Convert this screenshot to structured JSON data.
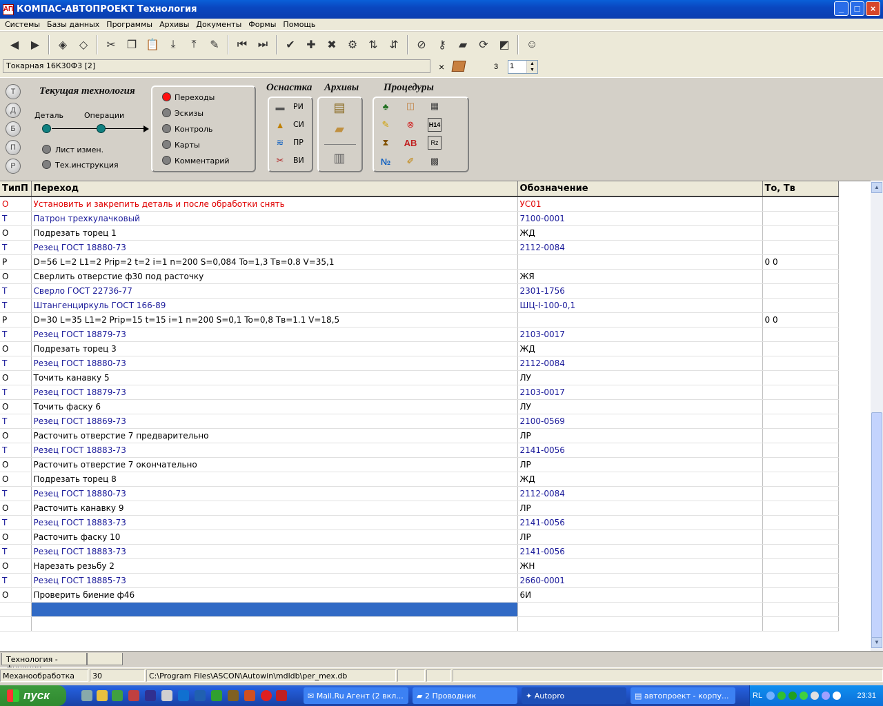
{
  "window": {
    "title": "КОМПАС-АВТОПРОЕКТ Технология",
    "app_icon": "АП"
  },
  "menu": [
    "Системы",
    "Базы данных",
    "Программы",
    "Архивы",
    "Документы",
    "Формы",
    "Помощь"
  ],
  "toolbar": {
    "icons": [
      "prev-icon",
      "next-icon",
      "sep",
      "check-icon",
      "uncheck-icon",
      "sep",
      "cut-icon",
      "copy-icon",
      "paste-icon",
      "import-icon",
      "export-icon",
      "edit-icon",
      "sep",
      "first-icon",
      "last-icon",
      "sep",
      "tool-check-icon",
      "tool-add-icon",
      "tool-remove-icon",
      "tools-icon",
      "sort-az-icon",
      "sort-za-icon",
      "sep",
      "stop-icon",
      "key-icon",
      "folder-icon",
      "refresh-icon",
      "erase-icon",
      "sep",
      "run-icon"
    ]
  },
  "combo": {
    "value": "Токарная 16К30Ф3  [2]",
    "close": "×",
    "count": "3",
    "spin_value": "1"
  },
  "panel": {
    "side_buttons": [
      "Т",
      "Д",
      "Б",
      "П",
      "Р"
    ],
    "current_tech": "Текущая технология",
    "detail": "Деталь",
    "operations": "Операции",
    "change_sheet": "Лист измен.",
    "tech_instr": "Тех.инструкция",
    "options": [
      "Переходы",
      "Эскизы",
      "Контроль",
      "Карты",
      "Комментарий"
    ],
    "osnastka": "Оснастка",
    "archives": "Архивы",
    "procedures": "Процедуры",
    "osnastka_items": [
      "РИ",
      "СИ",
      "ПР",
      "ВИ"
    ]
  },
  "grid": {
    "columns": [
      "ТипП",
      "Переход",
      "Обозначение",
      "То, Тв"
    ],
    "rows": [
      {
        "type": "О",
        "text": "Установить и  закрепить деталь и после обработки снять",
        "code": "УС01",
        "time": "",
        "style": "red"
      },
      {
        "type": "Т",
        "text": "Патрон  трехкулачковый",
        "code": "7100-0001",
        "time": "",
        "style": "T"
      },
      {
        "type": "О",
        "text": "Подрезать торец 1",
        "code": "ЖД",
        "time": "",
        "style": "O"
      },
      {
        "type": "Т",
        "text": "Резец    ГОСТ 18880-73",
        "code": "2112-0084",
        "time": "",
        "style": "T"
      },
      {
        "type": "Р",
        "text": "  D=56  L=2  L1=2  Prip=2  t=2  i=1  n=200  S=0,084  To=1,3  Тв=0.8  V=35,1",
        "code": "",
        "time": "0 0",
        "style": "P"
      },
      {
        "type": "О",
        "text": "Сверлить отверстие ф30 под расточку",
        "code": "ЖЯ",
        "time": "",
        "style": "O"
      },
      {
        "type": "Т",
        "text": "Сверло    ГОСТ 22736-77",
        "code": "2301-1756",
        "time": "",
        "style": "T"
      },
      {
        "type": "Т",
        "text": "Штангенциркуль ГОСТ 166-89",
        "code": "ШЦ-I-100-0,1",
        "time": "",
        "style": "T"
      },
      {
        "type": "Р",
        "text": "  D=30  L=35  L1=2  Prip=15  t=15  i=1  n=200  S=0,1  To=0,8  Тв=1.1  V=18,5",
        "code": "",
        "time": "0 0",
        "style": "P"
      },
      {
        "type": "Т",
        "text": "Резец   ГОСТ 18879-73",
        "code": "2103-0017",
        "time": "",
        "style": "T"
      },
      {
        "type": "О",
        "text": "Подрезать торец 3",
        "code": "ЖД",
        "time": "",
        "style": "O"
      },
      {
        "type": "Т",
        "text": "Резец    ГОСТ 18880-73",
        "code": "2112-0084",
        "time": "",
        "style": "T"
      },
      {
        "type": "О",
        "text": "Точить канавку 5",
        "code": "ЛУ",
        "time": "",
        "style": "O"
      },
      {
        "type": "Т",
        "text": "Резец   ГОСТ 18879-73",
        "code": "2103-0017",
        "time": "",
        "style": "T"
      },
      {
        "type": "О",
        "text": "Точить фаску 6",
        "code": "ЛУ",
        "time": "",
        "style": "O"
      },
      {
        "type": "Т",
        "text": "Резец   ГОСТ 18869-73",
        "code": "2100-0569",
        "time": "",
        "style": "T"
      },
      {
        "type": "О",
        "text": "Расточить отверстие 7 предварительно",
        "code": "ЛР",
        "time": "",
        "style": "O"
      },
      {
        "type": "Т",
        "text": "Резец ГОСТ 18883-73",
        "code": "2141-0056",
        "time": "",
        "style": "T"
      },
      {
        "type": "О",
        "text": "Расточить отверстие 7 окончательно",
        "code": "ЛР",
        "time": "",
        "style": "O"
      },
      {
        "type": "О",
        "text": "Подрезать торец 8",
        "code": "ЖД",
        "time": "",
        "style": "O"
      },
      {
        "type": "Т",
        "text": "Резец    ГОСТ 18880-73",
        "code": "2112-0084",
        "time": "",
        "style": "T"
      },
      {
        "type": "О",
        "text": "Расточить канавку 9",
        "code": "ЛР",
        "time": "",
        "style": "O"
      },
      {
        "type": "Т",
        "text": "Резец ГОСТ 18883-73",
        "code": "2141-0056",
        "time": "",
        "style": "T"
      },
      {
        "type": "О",
        "text": "Расточить фаску 10",
        "code": "ЛР",
        "time": "",
        "style": "O"
      },
      {
        "type": "Т",
        "text": "Резец ГОСТ 18883-73",
        "code": "2141-0056",
        "time": "",
        "style": "T"
      },
      {
        "type": "О",
        "text": "Нарезать резьбу 2",
        "code": "ЖН",
        "time": "",
        "style": "O"
      },
      {
        "type": "Т",
        "text": "Резец    ГОСТ 18885-73",
        "code": "2660-0001",
        "time": "",
        "style": "T"
      },
      {
        "type": "О",
        "text": "Проверить биение ф46",
        "code": "6И",
        "time": "",
        "style": "O"
      }
    ]
  },
  "tabs": [
    "Технология - функции"
  ],
  "status": {
    "mode": "Механообработка",
    "num": "30",
    "path": "C:\\Program Files\\ASCON\\Autowin\\mdldb\\per_mex.db"
  },
  "taskbar": {
    "start": "пуск",
    "buttons": [
      "Mail.Ru Агент (2 вкл...",
      "2 Проводник",
      "Autopro",
      "автопроект - корпу..."
    ],
    "lang": "RL",
    "clock": "23:31"
  },
  "colors": {
    "title": "#0a47c0",
    "selection": "#316ac5",
    "red_text": "#e00000",
    "tool_text": "#1a1a9a"
  }
}
